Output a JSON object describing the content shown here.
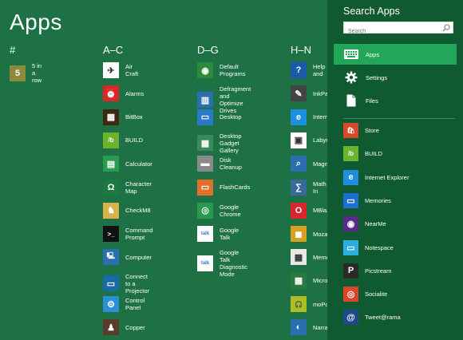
{
  "screen": {
    "title": "Apps"
  },
  "groups": [
    {
      "header": "#",
      "items": [
        {
          "label": "5 in a row",
          "icon": "five-in-a-row-icon",
          "color": "#8a8a3a",
          "glyph": "5"
        }
      ]
    },
    {
      "header": "A–C",
      "items": [
        {
          "label": "Air Craft",
          "icon": "aircraft-icon",
          "color": "#ffffff",
          "glyph": "✈"
        },
        {
          "label": "Alarms",
          "icon": "alarm-clock-icon",
          "color": "#d9262b",
          "glyph": "⏰"
        },
        {
          "label": "BitBox",
          "icon": "bitbox-icon",
          "color": "#3c2a14",
          "glyph": "▦"
        },
        {
          "label": "BUILD",
          "icon": "build-icon",
          "color": "#6ab42d",
          "glyph": "/b"
        },
        {
          "label": "Calculator",
          "icon": "calculator-icon",
          "color": "#2a9a50",
          "glyph": "▤"
        },
        {
          "label": "Character Map",
          "icon": "character-map-icon",
          "color": "#1b7a42",
          "glyph": "Ω"
        },
        {
          "label": "CheckM8",
          "icon": "checkm8-icon",
          "color": "#d8b24a",
          "glyph": "♞"
        },
        {
          "label": "Command Prompt",
          "icon": "command-prompt-icon",
          "color": "#111111",
          "glyph": ">_"
        },
        {
          "label": "Computer",
          "icon": "computer-icon",
          "color": "#2a6fb0",
          "glyph": "🖳"
        },
        {
          "label": "Connect to a Projector",
          "icon": "projector-icon",
          "color": "#1b6aa8",
          "glyph": "▭"
        },
        {
          "label": "Control Panel",
          "icon": "control-panel-icon",
          "color": "#2a8fd6",
          "glyph": "⚙"
        },
        {
          "label": "Copper",
          "icon": "copper-icon",
          "color": "#5a3a2a",
          "glyph": "♟"
        }
      ]
    },
    {
      "header": "D–G",
      "items": [
        {
          "label": "Default Programs",
          "icon": "default-programs-icon",
          "color": "#2c8a3c",
          "glyph": "◉"
        },
        {
          "label": "Defragment and\nOptimize Drives",
          "icon": "defragment-icon",
          "color": "#2a6fb0",
          "glyph": "▥"
        },
        {
          "label": "Desktop",
          "icon": "desktop-icon",
          "color": "#2a78c8",
          "glyph": "▭"
        },
        {
          "label": "Desktop Gadget\nGallery",
          "icon": "gadget-gallery-icon",
          "color": "#3a8a5a",
          "glyph": "▦"
        },
        {
          "label": "Disk Cleanup",
          "icon": "disk-cleanup-icon",
          "color": "#8a8a8a",
          "glyph": "▬"
        },
        {
          "label": "FlashCards",
          "icon": "flashcards-icon",
          "color": "#e0702a",
          "glyph": "▭"
        },
        {
          "label": "Google Chrome",
          "icon": "chrome-icon",
          "color": "#2a9a50",
          "glyph": "◎"
        },
        {
          "label": "Google Talk",
          "icon": "google-talk-icon",
          "color": "#ffffff",
          "glyph": "talk"
        },
        {
          "label": "Google Talk Diagnostic\nMode",
          "icon": "google-talk-diagnostic-icon",
          "color": "#ffffff",
          "glyph": "talk"
        }
      ]
    },
    {
      "header": "H–N",
      "items": [
        {
          "label": "Help and",
          "icon": "help-icon",
          "color": "#1b5aa8",
          "glyph": "?"
        },
        {
          "label": "InkPad",
          "icon": "inkpad-icon",
          "color": "#444444",
          "glyph": "✎"
        },
        {
          "label": "Interne",
          "icon": "internet-explorer-icon",
          "color": "#1e8fe0",
          "glyph": "e"
        },
        {
          "label": "Labyrin",
          "icon": "labyrinth-icon",
          "color": "#ffffff",
          "glyph": "▣"
        },
        {
          "label": "Magnif",
          "icon": "magnifier-icon",
          "color": "#2a6fb0",
          "glyph": "⌕"
        },
        {
          "label": "Math In",
          "icon": "math-input-icon",
          "color": "#3a6a9a",
          "glyph": "∑"
        },
        {
          "label": "MBlaze",
          "icon": "mblaze-icon",
          "color": "#d9262b",
          "glyph": "O"
        },
        {
          "label": "Mozaw",
          "icon": "mozaw-icon",
          "color": "#d8a020",
          "glyph": "◼"
        },
        {
          "label": "Memor",
          "icon": "memory-icon",
          "color": "#e8e8e8",
          "glyph": "▦"
        },
        {
          "label": "Micros",
          "icon": "microsoft-icon",
          "color": "#2a7a40",
          "glyph": "▦"
        },
        {
          "label": "moPod",
          "icon": "mopod-icon",
          "color": "#a8c020",
          "glyph": "🎧"
        },
        {
          "label": "Narrato",
          "icon": "narrator-icon",
          "color": "#2a6fb0",
          "glyph": "◐"
        }
      ]
    }
  ],
  "search_pane": {
    "title": "Search Apps",
    "search_placeholder": "Search",
    "filters": [
      {
        "label": "Apps",
        "icon": "apps-keyboard-icon",
        "selected": true
      },
      {
        "label": "Settings",
        "icon": "settings-gear-icon",
        "selected": false
      },
      {
        "label": "Files",
        "icon": "files-document-icon",
        "selected": false
      }
    ],
    "results": [
      {
        "label": "Store",
        "icon": "store-icon",
        "color": "#d9482b",
        "glyph": "🛍"
      },
      {
        "label": "BUILD",
        "icon": "build-icon",
        "color": "#6ab42d",
        "glyph": "/b"
      },
      {
        "label": "Internet Explorer",
        "icon": "internet-explorer-icon",
        "color": "#1e8fe0",
        "glyph": "e"
      },
      {
        "label": "Memories",
        "icon": "memories-icon",
        "color": "#1e6fd0",
        "glyph": "▭"
      },
      {
        "label": "NearMe",
        "icon": "nearme-icon",
        "color": "#5a2a8a",
        "glyph": "◉"
      },
      {
        "label": "Notespace",
        "icon": "notespace-icon",
        "color": "#2ab0e0",
        "glyph": "▭"
      },
      {
        "label": "Picstream",
        "icon": "picstream-icon",
        "color": "#2a2a2a",
        "glyph": "P"
      },
      {
        "label": "Socialite",
        "icon": "socialite-icon",
        "color": "#d9442b",
        "glyph": "◎"
      },
      {
        "label": "Tweet@rama",
        "icon": "tweetarama-icon",
        "color": "#1e4a8a",
        "glyph": "@"
      }
    ]
  }
}
